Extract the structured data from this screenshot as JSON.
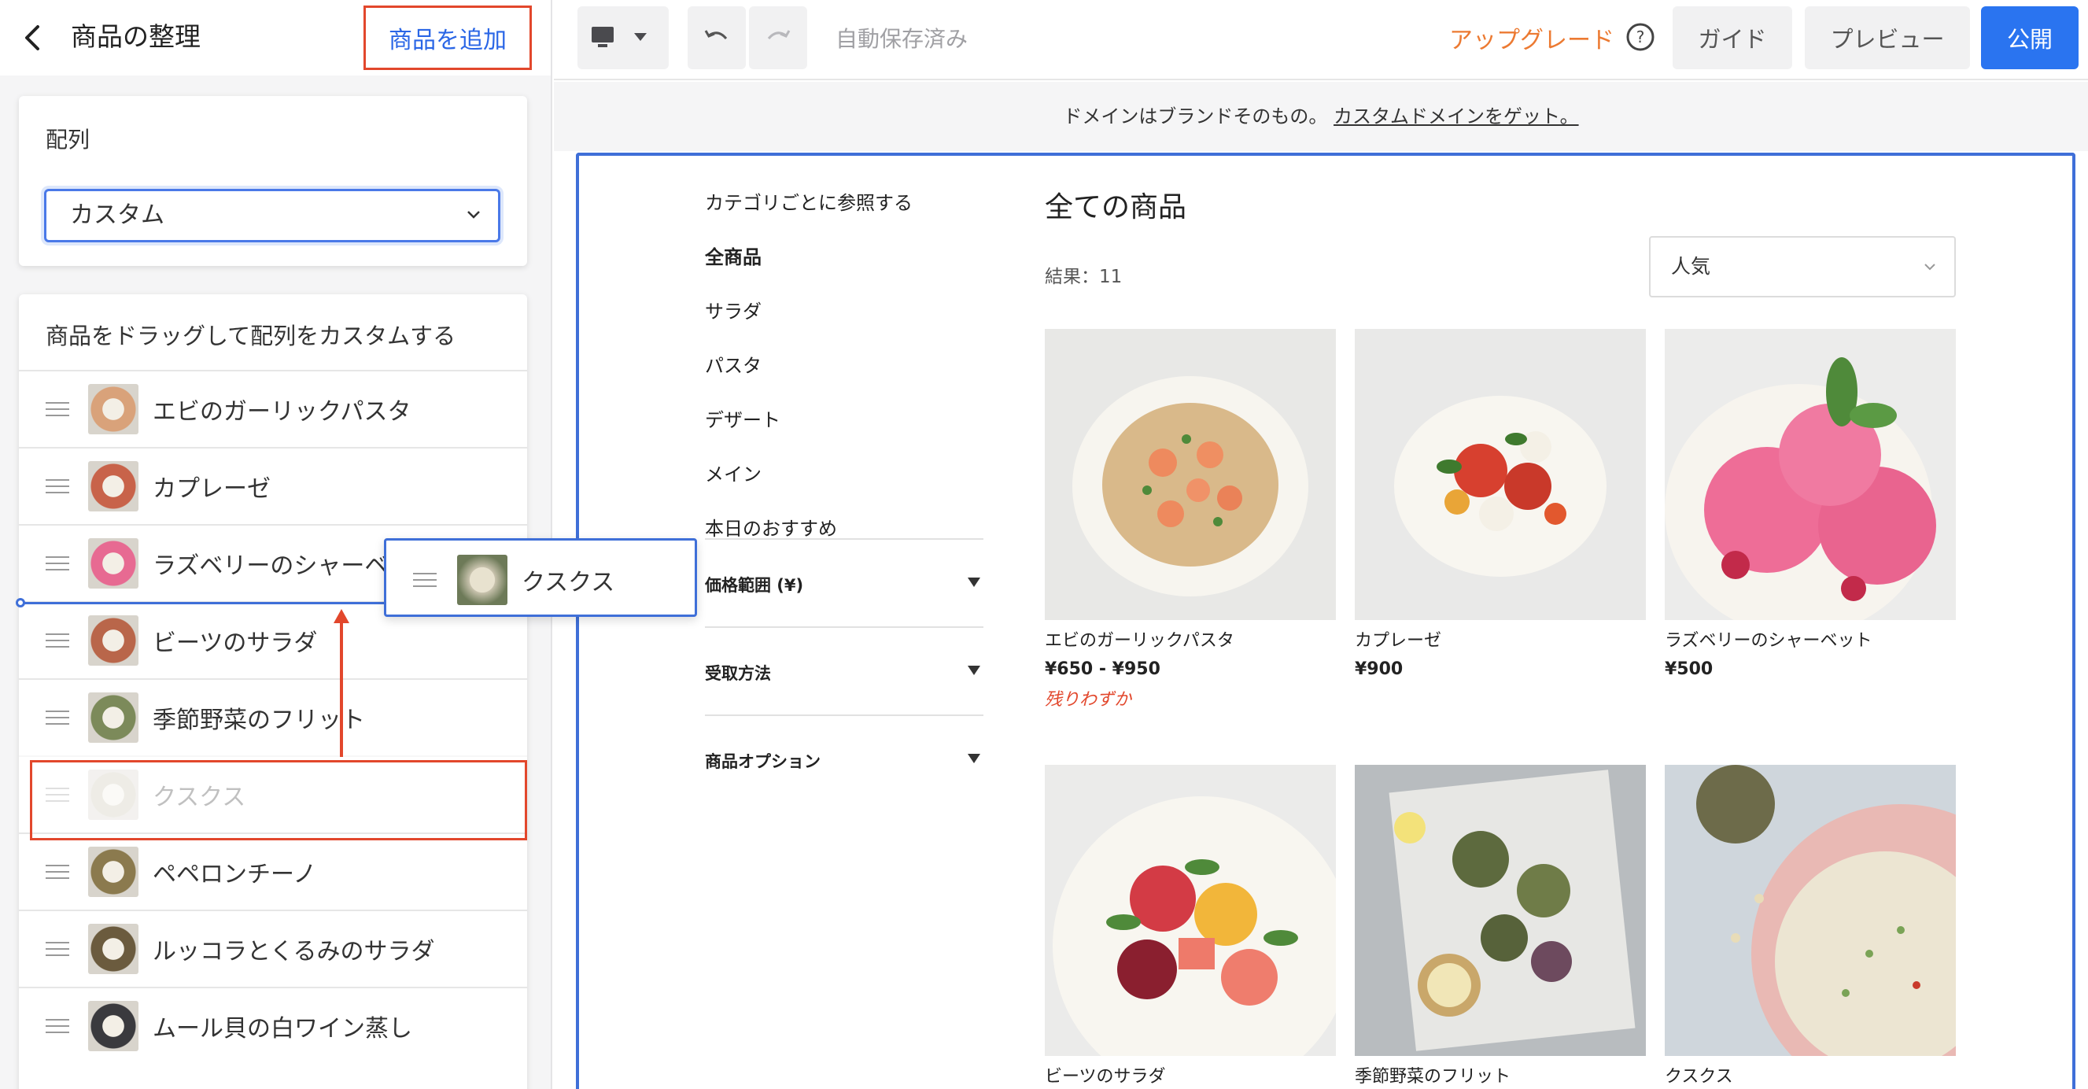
{
  "left_panel": {
    "title": "商品の整理",
    "add_button": "商品を追加",
    "sort": {
      "label": "配列",
      "value": "カスタム"
    },
    "list_heading": "商品をドラッグして配列をカスタムする",
    "items": [
      {
        "name": "エビのガーリックパスタ",
        "thumb": "#d9a27a"
      },
      {
        "name": "カプレーゼ",
        "thumb": "#c8634a"
      },
      {
        "name": "ラズベリーのシャーベット",
        "thumb": "#e76a92"
      },
      {
        "name": "ビーツのサラダ",
        "thumb": "#b9664a"
      },
      {
        "name": "季節野菜のフリット",
        "thumb": "#7c8a5a"
      },
      {
        "name": "クスクス",
        "thumb": "#c9c3ae"
      },
      {
        "name": "ペペロンチーノ",
        "thumb": "#8b7a4e"
      },
      {
        "name": "ルッコラとくるみのサラダ",
        "thumb": "#6b5b3e"
      },
      {
        "name": "ムール貝の白ワイン蒸し",
        "thumb": "#3a3a3e"
      }
    ],
    "drag_item": {
      "name": "クスクス"
    }
  },
  "topbar": {
    "autosave": "自動保存済み",
    "upgrade": "アップグレード",
    "guide": "ガイド",
    "preview": "プレビュー",
    "publish": "公開"
  },
  "banner": {
    "text": "ドメインはブランドそのもの。",
    "link": "カスタムドメインをゲット。"
  },
  "store": {
    "categories_heading": "カテゴリごとに参照する",
    "categories": [
      "全商品",
      "サラダ",
      "パスタ",
      "デザート",
      "メイン",
      "本日のおすすめ"
    ],
    "filters": [
      "価格範囲 (¥)",
      "受取方法",
      "商品オプション"
    ],
    "title": "全ての商品",
    "results": "結果：11",
    "sort_value": "人気",
    "products": [
      {
        "name": "エビのガーリックパスタ",
        "price": "¥650 - ¥950",
        "stock": "残りわずか"
      },
      {
        "name": "カプレーゼ",
        "price": "¥900",
        "stock": ""
      },
      {
        "name": "ラズベリーのシャーベット",
        "price": "¥500",
        "stock": ""
      },
      {
        "name": "ビーツのサラダ",
        "price": "",
        "stock": ""
      },
      {
        "name": "季節野菜のフリット",
        "price": "",
        "stock": ""
      },
      {
        "name": "クスクス",
        "price": "",
        "stock": ""
      }
    ]
  },
  "colors": {
    "accent_blue": "#2a74f0",
    "highlight_red": "#e2472c",
    "upgrade_orange": "#ec7a32"
  }
}
